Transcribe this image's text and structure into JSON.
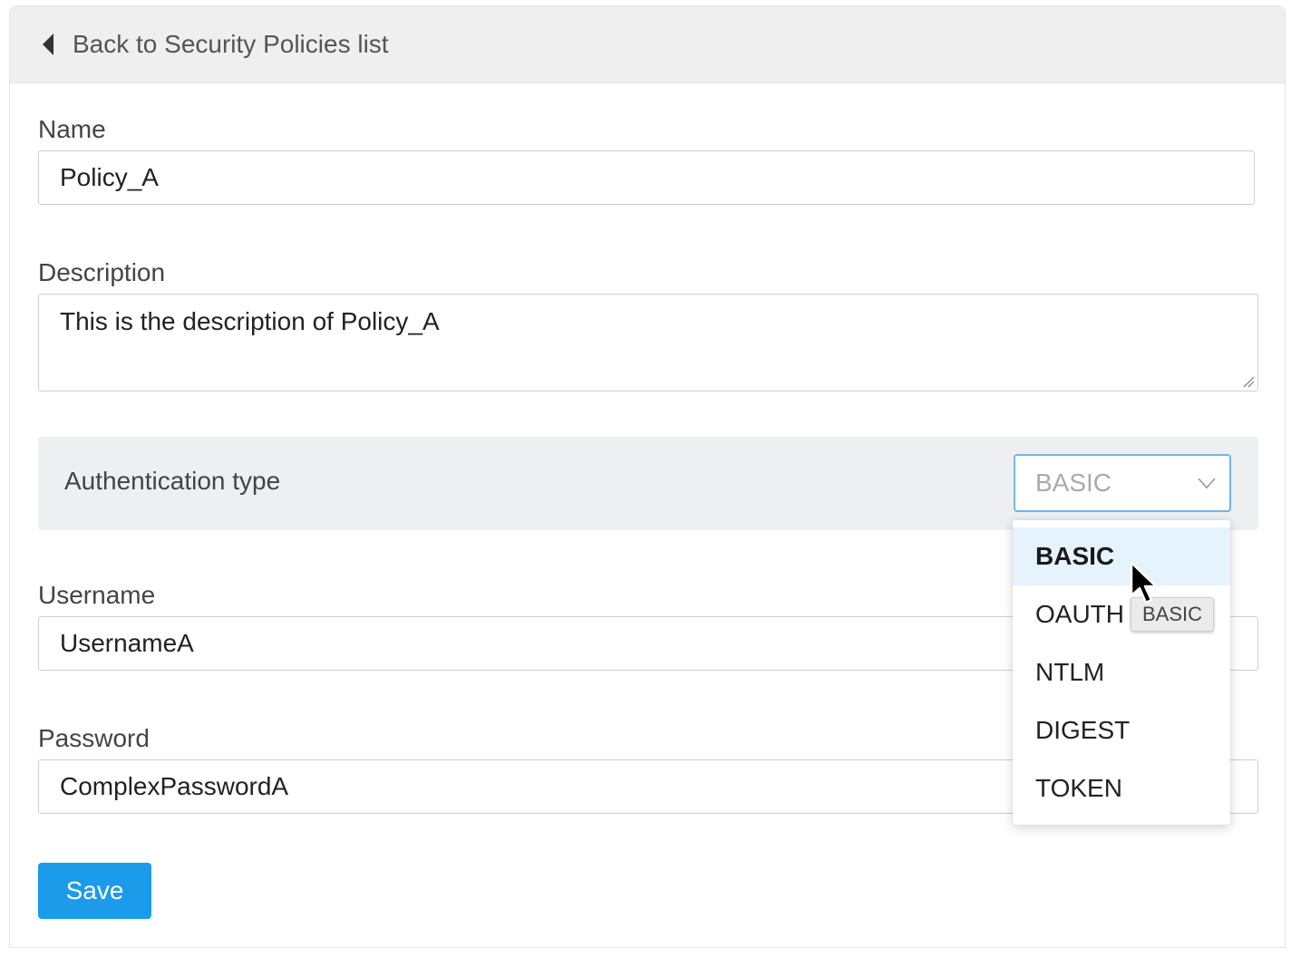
{
  "header": {
    "back_icon": "chevron-left-icon",
    "back_label": "Back to Security Policies list"
  },
  "form": {
    "name": {
      "label": "Name",
      "value": "Policy_A"
    },
    "description": {
      "label": "Description",
      "value": "This is the description of Policy_A"
    },
    "authentication": {
      "label": "Authentication type",
      "selected": "BASIC",
      "chevron_icon": "chevron-down-icon",
      "options": [
        "BASIC",
        "OAUTH",
        "NTLM",
        "DIGEST",
        "TOKEN"
      ],
      "tooltip": "BASIC"
    },
    "username": {
      "label": "Username",
      "value": "UsernameA"
    },
    "password": {
      "label": "Password",
      "value": "ComplexPasswordA"
    },
    "save_label": "Save"
  },
  "colors": {
    "primary": "#1b9be9",
    "select_focus_border": "#72b5e8",
    "option_highlight": "#e5f4fc",
    "header_bg": "#efeff0"
  }
}
